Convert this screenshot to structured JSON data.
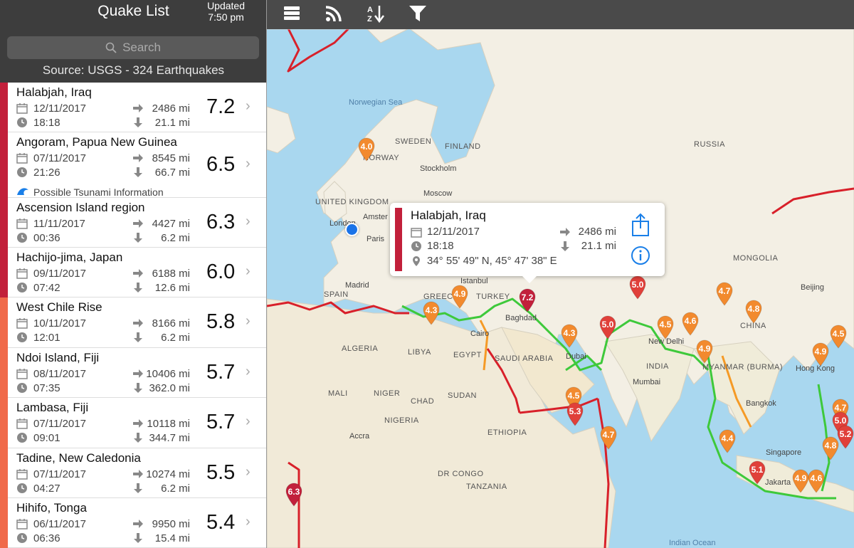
{
  "header": {
    "title": "Quake List",
    "updated_label": "Updated",
    "updated_time": "7:50 pm"
  },
  "search": {
    "placeholder": "Search"
  },
  "source": "Source: USGS - 324 Earthquakes",
  "quakes": [
    {
      "place": "Halabjah, Iraq",
      "date": "12/11/2017",
      "time": "18:18",
      "distance": "2486 mi",
      "depth": "21.1 mi",
      "magnitude": "7.2",
      "color": "#c2203b"
    },
    {
      "place": "Angoram, Papua New Guinea",
      "date": "07/11/2017",
      "time": "21:26",
      "distance": "8545 mi",
      "depth": "66.7 mi",
      "magnitude": "6.5",
      "color": "#c2203b",
      "note": "Possible Tsunami Information"
    },
    {
      "place": "Ascension Island region",
      "date": "11/11/2017",
      "time": "00:36",
      "distance": "4427 mi",
      "depth": "6.2 mi",
      "magnitude": "6.3",
      "color": "#c2203b"
    },
    {
      "place": "Hachijo-jima, Japan",
      "date": "09/11/2017",
      "time": "07:42",
      "distance": "6188 mi",
      "depth": "12.6 mi",
      "magnitude": "6.0",
      "color": "#c2203b"
    },
    {
      "place": "West Chile Rise",
      "date": "10/11/2017",
      "time": "12:01",
      "distance": "8166 mi",
      "depth": "6.2 mi",
      "magnitude": "5.8",
      "color": "#f06a4a"
    },
    {
      "place": "Ndoi Island, Fiji",
      "date": "08/11/2017",
      "time": "07:35",
      "distance": "10406 mi",
      "depth": "362.0 mi",
      "magnitude": "5.7",
      "color": "#f06a4a"
    },
    {
      "place": "Lambasa, Fiji",
      "date": "07/11/2017",
      "time": "09:01",
      "distance": "10118 mi",
      "depth": "344.7 mi",
      "magnitude": "5.7",
      "color": "#f06a4a"
    },
    {
      "place": "Tadine, New Caledonia",
      "date": "07/11/2017",
      "time": "04:27",
      "distance": "10274 mi",
      "depth": "6.2 mi",
      "magnitude": "5.5",
      "color": "#f06a4a"
    },
    {
      "place": "Hihifo, Tonga",
      "date": "06/11/2017",
      "time": "06:36",
      "distance": "9950 mi",
      "depth": "15.4 mi",
      "magnitude": "5.4",
      "color": "#f06a4a"
    }
  ],
  "toolbar": {
    "icons": [
      "menu-icon",
      "rss-feed-icon",
      "sort-az-icon",
      "filter-icon"
    ]
  },
  "callout": {
    "place": "Halabjah, Iraq",
    "date": "12/11/2017",
    "time": "18:18",
    "distance": "2486 mi",
    "depth": "21.1 mi",
    "coordinates": "34° 55' 49\" N, 45° 47' 38\" E"
  },
  "map_labels": [
    "Norwegian Sea",
    "SWEDEN",
    "FINLAND",
    "NORWAY",
    "Stockholm",
    "RUSSIA",
    "UNITED KINGDOM",
    "London",
    "Amster",
    "Paris",
    "Moscow",
    "MONGOLIA",
    "Madrid",
    "SPAIN",
    "GREECE",
    "TURKEY",
    "Istanbul",
    "Beijing",
    "ALGERIA",
    "LIBYA",
    "EGYPT",
    "Cairo",
    "Baghdad",
    "SAUDI ARABIA",
    "Dubai",
    "New Delhi",
    "INDIA",
    "Mumbai",
    "MALI",
    "NIGER",
    "CHAD",
    "SUDAN",
    "NIGERIA",
    "ETHIOPIA",
    "Accra",
    "DR CONGO",
    "TANZANIA",
    "Bangkok",
    "Hong Kong",
    "Singapore",
    "Jakarta",
    "CHINA",
    "MYANMAR (BURMA)",
    "Indian Ocean"
  ],
  "pins": [
    {
      "mag": "4.0",
      "color": "#f28a2e"
    },
    {
      "mag": "7.2",
      "color": "#c2203b"
    },
    {
      "mag": "4.3",
      "color": "#f28a2e"
    },
    {
      "mag": "4.9",
      "color": "#f28a2e"
    },
    {
      "mag": "4.3",
      "color": "#f28a2e"
    },
    {
      "mag": "5.0",
      "color": "#e0403a"
    },
    {
      "mag": "5.0",
      "color": "#e0403a"
    },
    {
      "mag": "4.5",
      "color": "#f28a2e"
    },
    {
      "mag": "4.6",
      "color": "#f28a2e"
    },
    {
      "mag": "4.7",
      "color": "#f28a2e"
    },
    {
      "mag": "4.8",
      "color": "#f28a2e"
    },
    {
      "mag": "4.9",
      "color": "#f28a2e"
    },
    {
      "mag": "4.5",
      "color": "#f28a2e"
    },
    {
      "mag": "5.3",
      "color": "#e0403a"
    },
    {
      "mag": "4.7",
      "color": "#f28a2e"
    },
    {
      "mag": "6.3",
      "color": "#c2203b"
    },
    {
      "mag": "4.4",
      "color": "#f28a2e"
    },
    {
      "mag": "5.1",
      "color": "#e0403a"
    },
    {
      "mag": "4.9",
      "color": "#f28a2e"
    },
    {
      "mag": "4.6",
      "color": "#f28a2e"
    },
    {
      "mag": "4.9",
      "color": "#f28a2e"
    },
    {
      "mag": "4.5",
      "color": "#f28a2e"
    },
    {
      "mag": "4.7",
      "color": "#f28a2e"
    },
    {
      "mag": "5.0",
      "color": "#e0403a"
    },
    {
      "mag": "5.2",
      "color": "#e0403a"
    },
    {
      "mag": "4.8",
      "color": "#f28a2e"
    }
  ]
}
